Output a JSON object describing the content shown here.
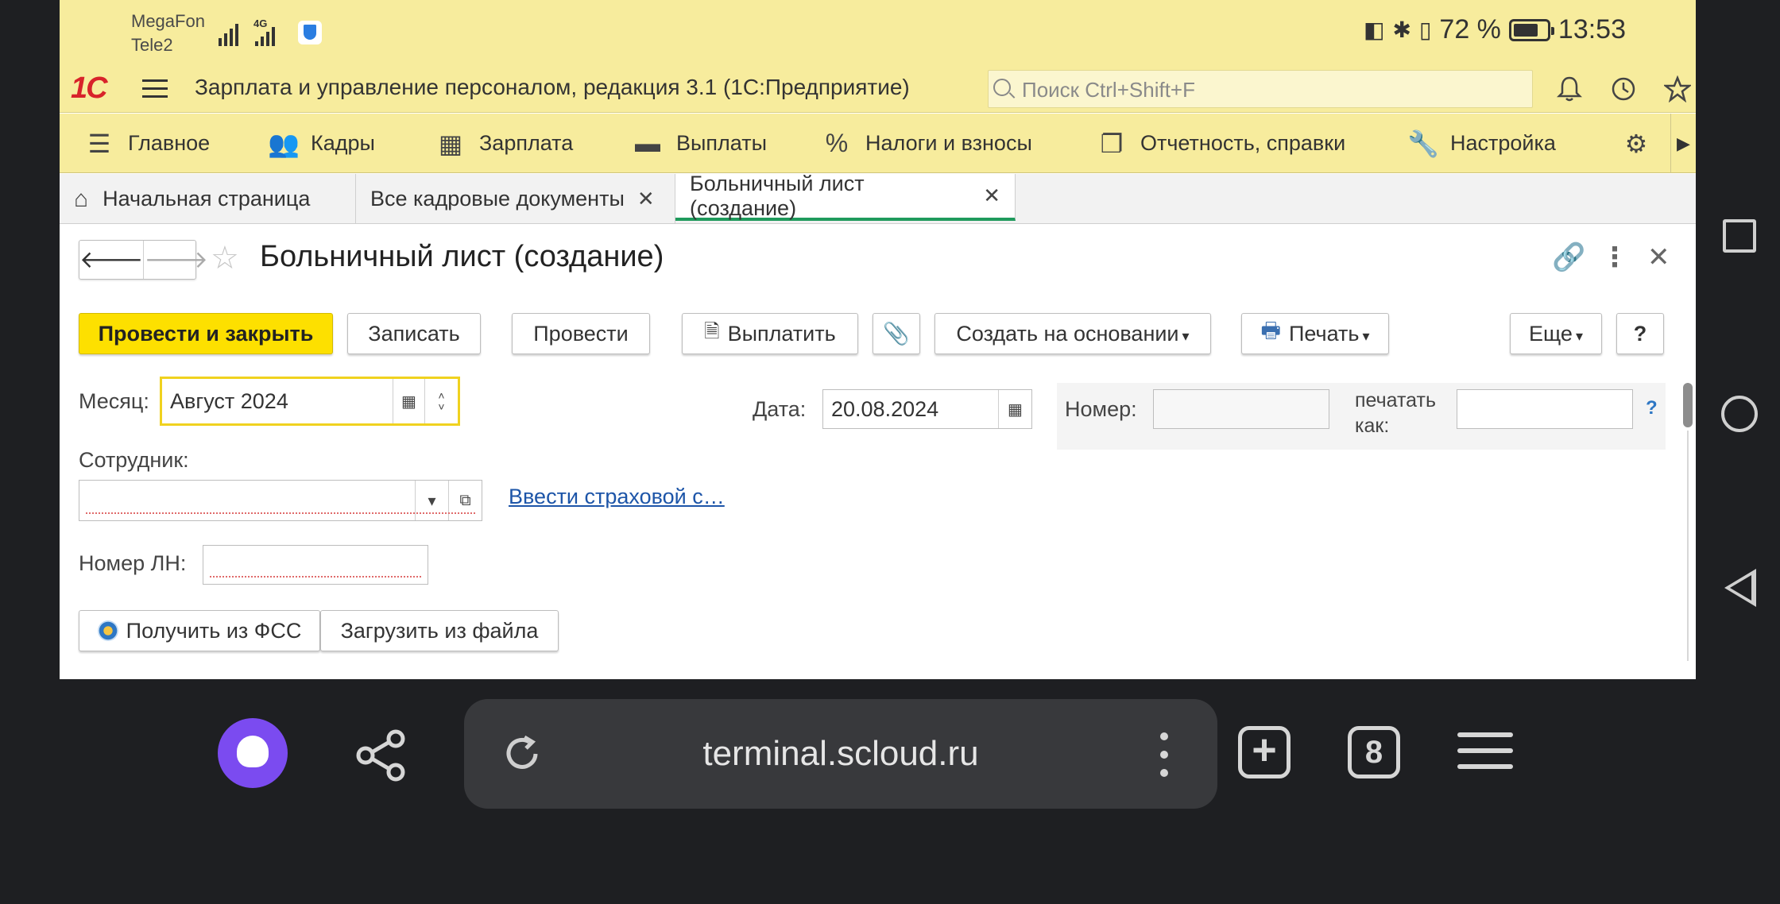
{
  "status_bar": {
    "carrier1": "MegaFon",
    "carrier2": "Tele2",
    "network": "4G",
    "battery": "72 %",
    "time": "13:53"
  },
  "app": {
    "logo": "1С",
    "title": "Зарплата и управление персоналом, редакция 3.1  (1С:Предприятие)",
    "search_placeholder": "Поиск Ctrl+Shift+F"
  },
  "sections": [
    {
      "label": "Главное",
      "icon": "list-icon"
    },
    {
      "label": "Кадры",
      "icon": "people-icon"
    },
    {
      "label": "Зарплата",
      "icon": "calculator-icon"
    },
    {
      "label": "Выплаты",
      "icon": "wallet-icon"
    },
    {
      "label": "Налоги и взносы",
      "icon": "percent-icon"
    },
    {
      "label": "Отчетность, справки",
      "icon": "documents-icon"
    },
    {
      "label": "Настройка",
      "icon": "wrench-icon"
    }
  ],
  "tabs": [
    {
      "label": "Начальная страница"
    },
    {
      "label": "Все кадровые документы"
    },
    {
      "label": "Больничный лист (создание)"
    }
  ],
  "form": {
    "title": "Больничный лист (создание)",
    "buttons": {
      "post_close": "Провести и закрыть",
      "save": "Записать",
      "post": "Провести",
      "pay": "Выплатить",
      "create_based": "Создать на основании",
      "print": "Печать",
      "more": "Еще",
      "help": "?"
    },
    "month_label": "Месяц:",
    "month_value": "Август 2024",
    "date_label": "Дата:",
    "date_value": "20.08.2024",
    "number_label": "Номер:",
    "number_value": "",
    "print_as_label_1": "печатать",
    "print_as_label_2": "как:",
    "print_as_value": "",
    "help_mark": "?",
    "employee_label": "Сотрудник:",
    "employee_value": "",
    "insurance_link": "Ввести страховой с…",
    "ln_label": "Номер ЛН:",
    "ln_value": "",
    "get_fss": "Получить из ФСС",
    "load_file": "Загрузить из файла"
  },
  "browser": {
    "url": "terminal.scloud.ru",
    "tabs_count": "8"
  }
}
